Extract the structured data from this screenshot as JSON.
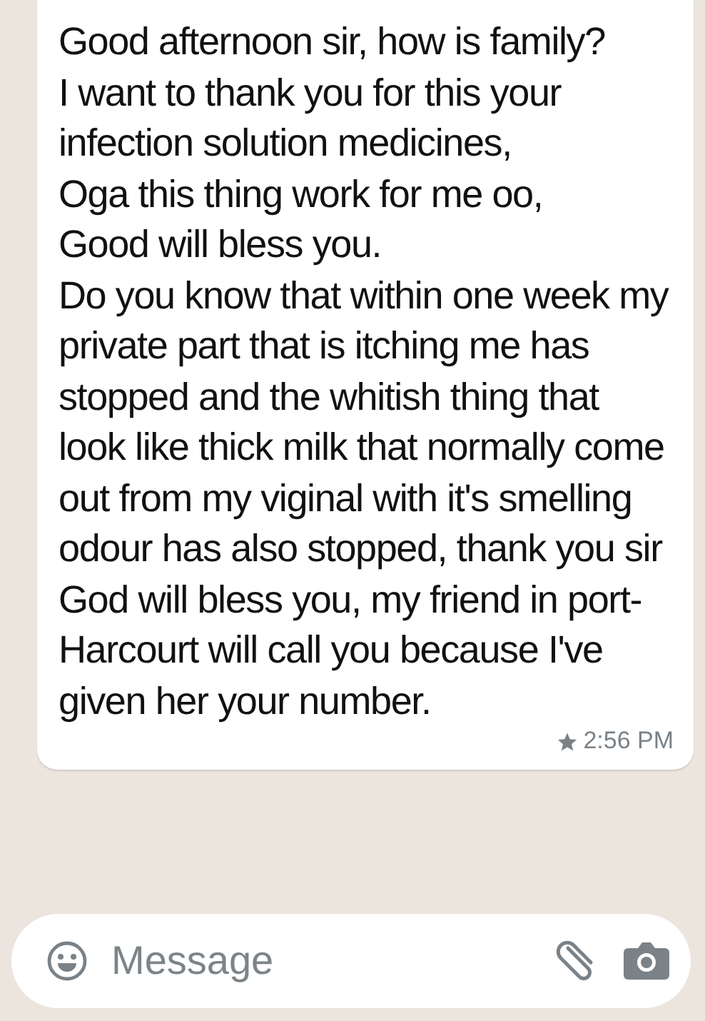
{
  "message": {
    "text": "Good afternoon sir, how is family?\nI want to thank you for this your infection solution medicines,\nOga this thing work for me oo,\nGood will bless you.\nDo you know that within one week my private part that is itching me has stopped and the whitish thing that look like thick milk that normally come out from my viginal with it's smelling odour has also stopped, thank you sir God will bless you, my friend in port-Harcourt will call you because I've given her your number.",
    "starred": true,
    "time": "2:56 PM"
  },
  "composer": {
    "placeholder": "Message"
  }
}
